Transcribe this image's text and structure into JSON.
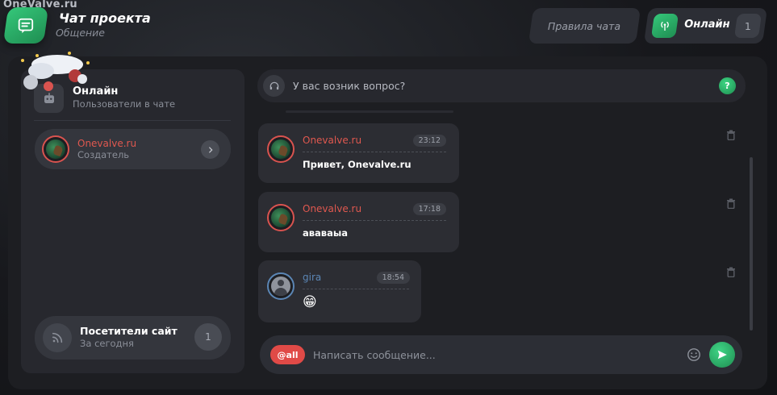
{
  "site": {
    "watermark": "OneValve.ru"
  },
  "header": {
    "title": "Чат проекта",
    "subtitle": "Общение",
    "rules_label": "Правила чата",
    "online_label": "Онлайн",
    "online_count": "1"
  },
  "sidebar": {
    "title": "Онлайн",
    "subtitle": "Пользователи в чате",
    "users": [
      {
        "name": "Onevalve.ru",
        "role": "Создатель"
      }
    ],
    "visitors": {
      "title": "Посетители сайт",
      "subtitle": "За сегодня",
      "count": "1"
    }
  },
  "question": {
    "text": "У вас возник вопрос?",
    "help_glyph": "?"
  },
  "messages": [
    {
      "author": "Onevalve.ru",
      "time": "23:12",
      "text": "Привет, Onevalve.ru",
      "author_color": "#e0584f"
    },
    {
      "author": "Onevalve.ru",
      "time": "17:18",
      "text": "ававаыа",
      "author_color": "#e0584f"
    },
    {
      "author": "gira",
      "time": "18:54",
      "text": "😁",
      "author_color": "#5b86b5"
    }
  ],
  "composer": {
    "mention_label": "@all",
    "placeholder": "Написать сообщение..."
  },
  "colors": {
    "accent_green": "#2fb86a",
    "accent_red": "#e04a47",
    "panel": "#1d1e22"
  },
  "icons": [
    "chat-icon",
    "antenna-icon",
    "headset-icon",
    "help-icon",
    "chevron-right-icon",
    "rss-icon",
    "trash-icon",
    "emoji-icon",
    "send-icon"
  ]
}
